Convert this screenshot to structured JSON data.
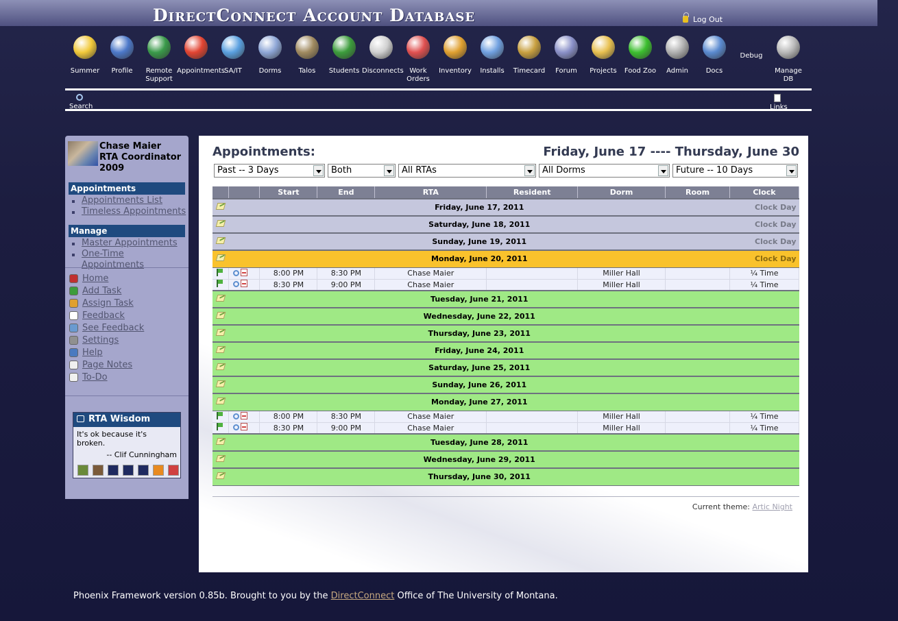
{
  "header": {
    "title": "DirectConnect Account Database",
    "logout": "Log Out"
  },
  "nav": [
    {
      "label": "Summer",
      "icon": "sun-face-icon",
      "color": "#f1c93a"
    },
    {
      "label": "Profile",
      "icon": "profile-card-icon",
      "color": "#4c78c9"
    },
    {
      "label": "Remote Support",
      "icon": "globe-icon",
      "color": "#3a9a4a"
    },
    {
      "label": "Appointments",
      "icon": "alarm-clock-icon",
      "color": "#e24432"
    },
    {
      "label": "SA/IT",
      "icon": "medical-cross-icon",
      "color": "#5aa0e0"
    },
    {
      "label": "Dorms",
      "icon": "building-icon",
      "color": "#8ea6d6"
    },
    {
      "label": "Talos",
      "icon": "helmet-icon",
      "color": "#a08a60"
    },
    {
      "label": "Students",
      "icon": "student-icon",
      "color": "#3c9c3c"
    },
    {
      "label": "Disconnects",
      "icon": "disconnect-icon",
      "color": "#d0d0d0"
    },
    {
      "label": "Work Orders",
      "icon": "work-order-icon",
      "color": "#e05050"
    },
    {
      "label": "Inventory",
      "icon": "box-icon",
      "color": "#e0a030"
    },
    {
      "label": "Installs",
      "icon": "install-icon",
      "color": "#70a0e0"
    },
    {
      "label": "Timecard",
      "icon": "money-bag-icon",
      "color": "#c8a040"
    },
    {
      "label": "Forum",
      "icon": "forum-icon",
      "color": "#8a90c8"
    },
    {
      "label": "Projects",
      "icon": "folder-icon",
      "color": "#e8c050"
    },
    {
      "label": "Food Zoo",
      "icon": "apple-icon",
      "color": "#3cbf2f"
    },
    {
      "label": "Admin",
      "icon": "admin-icon",
      "color": "#b0b0b0"
    },
    {
      "label": "Docs",
      "icon": "books-icon",
      "color": "#5a8ad0"
    },
    {
      "label": "Debug",
      "icon": "",
      "color": ""
    },
    {
      "label": "Manage DB",
      "icon": "database-icon",
      "color": "#b8b8b8"
    }
  ],
  "subnav": {
    "search": "Search",
    "links": "Links"
  },
  "sidebar": {
    "user_name": "Chase Maier",
    "user_role": "RTA Coordinator",
    "user_year": "2009",
    "appointments_head": "Appointments",
    "appointments_items": [
      "Appointments List",
      "Timeless Appointments"
    ],
    "manage_head": "Manage",
    "manage_items": [
      "Master Appointments",
      "One-Time Appointments"
    ],
    "tools": [
      {
        "label": "Home",
        "icon": "home-icon",
        "color": "#c03030"
      },
      {
        "label": "Add Task",
        "icon": "checkbox-icon",
        "color": "#3c9c3c"
      },
      {
        "label": "Assign Task",
        "icon": "assign-icon",
        "color": "#e0a030"
      },
      {
        "label": "Feedback",
        "icon": "info-icon",
        "color": "#ffffff"
      },
      {
        "label": "See Feedback",
        "icon": "magnifier-icon",
        "color": "#6a9ad0"
      },
      {
        "label": "Settings",
        "icon": "tools-icon",
        "color": "#909090"
      },
      {
        "label": "Help",
        "icon": "help-icon",
        "color": "#4a7ac0"
      },
      {
        "label": "Page Notes",
        "icon": "notes-icon",
        "color": "#f0f0f0"
      },
      {
        "label": "To-Do",
        "icon": "todo-icon",
        "color": "#f0f0f0"
      }
    ],
    "wisdom_title": "RTA Wisdom",
    "wisdom_quote": "It's ok because it's broken.",
    "wisdom_author": "-- Clif Cunningham"
  },
  "main": {
    "title": "Appointments:",
    "range": "Friday, June 17 ---- Thursday, June 30",
    "filters": [
      "Past -- 3 Days",
      "Both",
      "All RTAs",
      "All Dorms",
      "Future -- 10 Days"
    ],
    "columns": [
      "",
      "",
      "Start",
      "End",
      "RTA",
      "Resident",
      "Dorm",
      "Room",
      "Clock"
    ],
    "rows": [
      {
        "type": "day",
        "state": "past",
        "label": "Friday, June 17, 2011",
        "clock": "Clock Day"
      },
      {
        "type": "day",
        "state": "past",
        "label": "Saturday, June 18, 2011",
        "clock": "Clock Day"
      },
      {
        "type": "day",
        "state": "past",
        "label": "Sunday, June 19, 2011",
        "clock": "Clock Day"
      },
      {
        "type": "day",
        "state": "today",
        "label": "Monday, June 20, 2011",
        "clock": "Clock Day"
      },
      {
        "type": "appt",
        "start": "8:00 PM",
        "end": "8:30 PM",
        "rta": "Chase Maier",
        "resident": "",
        "dorm": "Miller Hall",
        "room": "",
        "clock": "¼ Time"
      },
      {
        "type": "appt",
        "start": "8:30 PM",
        "end": "9:00 PM",
        "rta": "Chase Maier",
        "resident": "",
        "dorm": "Miller Hall",
        "room": "",
        "clock": "¼ Time"
      },
      {
        "type": "day",
        "state": "future",
        "label": "Tuesday, June 21, 2011",
        "clock": ""
      },
      {
        "type": "day",
        "state": "future",
        "label": "Wednesday, June 22, 2011",
        "clock": ""
      },
      {
        "type": "day",
        "state": "future",
        "label": "Thursday, June 23, 2011",
        "clock": ""
      },
      {
        "type": "day",
        "state": "future",
        "label": "Friday, June 24, 2011",
        "clock": ""
      },
      {
        "type": "day",
        "state": "future",
        "label": "Saturday, June 25, 2011",
        "clock": ""
      },
      {
        "type": "day",
        "state": "future",
        "label": "Sunday, June 26, 2011",
        "clock": ""
      },
      {
        "type": "day",
        "state": "future",
        "label": "Monday, June 27, 2011",
        "clock": ""
      },
      {
        "type": "appt",
        "start": "8:00 PM",
        "end": "8:30 PM",
        "rta": "Chase Maier",
        "resident": "",
        "dorm": "Miller Hall",
        "room": "",
        "clock": "¼ Time"
      },
      {
        "type": "appt",
        "start": "8:30 PM",
        "end": "9:00 PM",
        "rta": "Chase Maier",
        "resident": "",
        "dorm": "Miller Hall",
        "room": "",
        "clock": "¼ Time"
      },
      {
        "type": "day",
        "state": "future",
        "label": "Tuesday, June 28, 2011",
        "clock": ""
      },
      {
        "type": "day",
        "state": "future",
        "label": "Wednesday, June 29, 2011",
        "clock": ""
      },
      {
        "type": "day",
        "state": "future",
        "label": "Thursday, June 30, 2011",
        "clock": ""
      }
    ],
    "theme_label": "Current theme:",
    "theme_value": "Artic Night"
  },
  "footer": {
    "prefix": "Phoenix Framework version 0.85b. Brought to you by the ",
    "link": "DirectConnect",
    "suffix": " Office of The University of Montana."
  },
  "colors": {
    "past_day": "#c5c7dd",
    "today": "#f9c22c",
    "future_day": "#9fe985",
    "header_bar": "#1f4a7f"
  }
}
